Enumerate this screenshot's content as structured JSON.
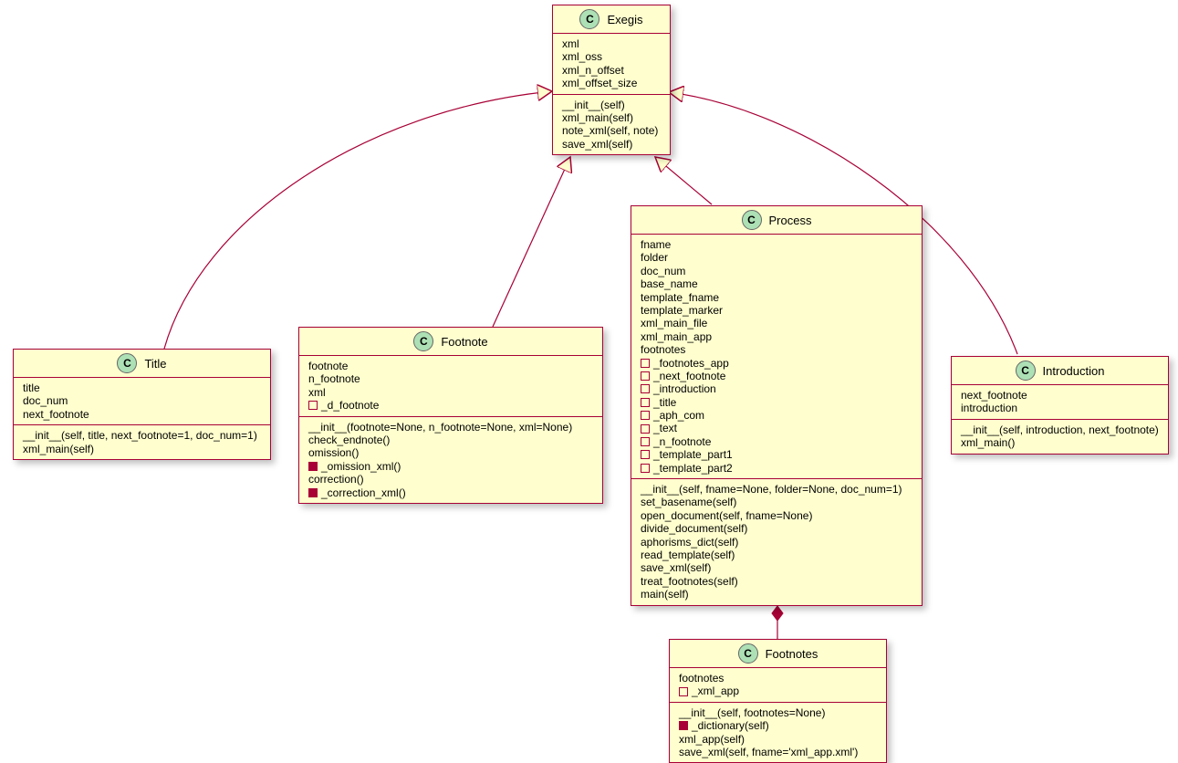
{
  "classes": {
    "exegis": {
      "name": "Exegis",
      "attrs": [
        "xml",
        "xml_oss",
        "xml_n_offset",
        "xml_offset_size"
      ],
      "methods": [
        "__init__(self)",
        "xml_main(self)",
        "note_xml(self, note)",
        "save_xml(self)"
      ]
    },
    "title": {
      "name": "Title",
      "attrs": [
        "title",
        "doc_num",
        "next_footnote"
      ],
      "methods": [
        "__init__(self, title, next_footnote=1, doc_num=1)",
        "xml_main(self)"
      ]
    },
    "footnote": {
      "name": "Footnote",
      "attrs": [
        {
          "t": "footnote"
        },
        {
          "t": "n_footnote"
        },
        {
          "t": "xml"
        },
        {
          "t": "_d_footnote",
          "vis": "private-open"
        }
      ],
      "methods": [
        {
          "t": "__init__(footnote=None, n_footnote=None, xml=None)"
        },
        {
          "t": "check_endnote()"
        },
        {
          "t": "omission()"
        },
        {
          "t": "_omission_xml()",
          "vis": "private-filled"
        },
        {
          "t": "correction()"
        },
        {
          "t": "_correction_xml()",
          "vis": "private-filled"
        }
      ]
    },
    "process": {
      "name": "Process",
      "attrs": [
        {
          "t": "fname"
        },
        {
          "t": "folder"
        },
        {
          "t": "doc_num"
        },
        {
          "t": "base_name"
        },
        {
          "t": "template_fname"
        },
        {
          "t": "template_marker"
        },
        {
          "t": "xml_main_file"
        },
        {
          "t": "xml_main_app"
        },
        {
          "t": "footnotes"
        },
        {
          "t": "_footnotes_app",
          "vis": "private-open"
        },
        {
          "t": "_next_footnote",
          "vis": "private-open"
        },
        {
          "t": "_introduction",
          "vis": "private-open"
        },
        {
          "t": "_title",
          "vis": "private-open"
        },
        {
          "t": "_aph_com",
          "vis": "private-open"
        },
        {
          "t": "_text",
          "vis": "private-open"
        },
        {
          "t": "_n_footnote",
          "vis": "private-open"
        },
        {
          "t": "_template_part1",
          "vis": "private-open"
        },
        {
          "t": "_template_part2",
          "vis": "private-open"
        }
      ],
      "methods": [
        "__init__(self, fname=None, folder=None, doc_num=1)",
        "set_basename(self)",
        "open_document(self, fname=None)",
        "divide_document(self)",
        "aphorisms_dict(self)",
        "read_template(self)",
        "save_xml(self)",
        "treat_footnotes(self)",
        "main(self)"
      ]
    },
    "introduction": {
      "name": "Introduction",
      "attrs": [
        "next_footnote",
        "introduction"
      ],
      "methods": [
        "__init__(self, introduction, next_footnote)",
        "xml_main()"
      ]
    },
    "footnotes": {
      "name": "Footnotes",
      "attrs": [
        {
          "t": "footnotes"
        },
        {
          "t": "_xml_app",
          "vis": "private-open"
        }
      ],
      "methods": [
        {
          "t": "__init__(self, footnotes=None)"
        },
        {
          "t": "_dictionary(self)",
          "vis": "private-filled"
        },
        {
          "t": "xml_app(self)"
        },
        {
          "t": "save_xml(self, fname='xml_app.xml')"
        }
      ]
    }
  }
}
